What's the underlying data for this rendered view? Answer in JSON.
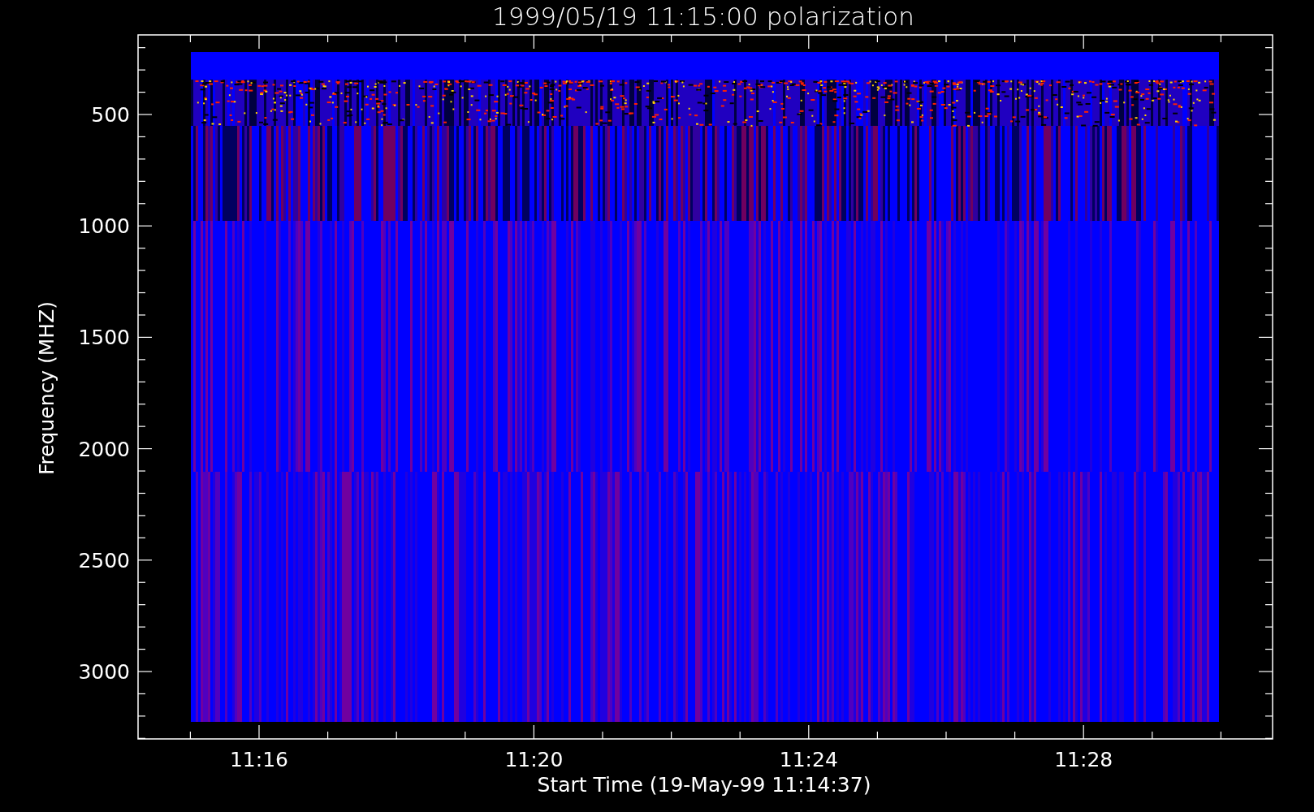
{
  "title": "1999/05/19 11:15:00 polarization",
  "y_axis": {
    "label": "Frequency (MHZ)",
    "tick_labels": [
      "500",
      "1000",
      "1500",
      "2000",
      "2500",
      "3000"
    ]
  },
  "x_axis": {
    "label": "Start Time (19-May-99 11:14:37)",
    "tick_labels": [
      "11:16",
      "11:20",
      "11:24",
      "11:28"
    ]
  }
}
